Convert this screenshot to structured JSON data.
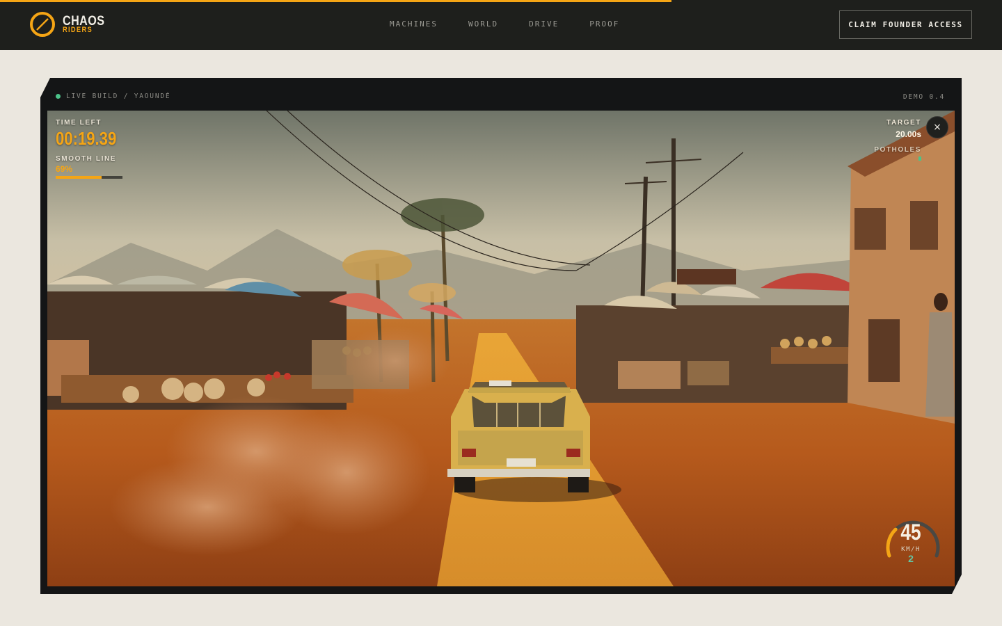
{
  "loading": {
    "progress": 0.67
  },
  "brand": {
    "line1": "CHAOS",
    "line2": "RIDERS",
    "accent": "#f5a515"
  },
  "nav": {
    "items": [
      {
        "label": "MACHINES"
      },
      {
        "label": "WORLD"
      },
      {
        "label": "DRIVE"
      },
      {
        "label": "PROOF"
      }
    ]
  },
  "cta": {
    "label": "CLAIM FOUNDER ACCESS"
  },
  "game": {
    "status_label": "LIVE BUILD / YAOUNDÉ",
    "version": "DEMO 0.4",
    "hud": {
      "time_left_label": "TIME LEFT",
      "time_left": "00:19.39",
      "smooth_line_label": "SMOOTH LINE",
      "smooth_line_value": "69%",
      "smooth_line_fraction": 0.69,
      "target_label": "TARGET",
      "target_value": "20.00s",
      "potholes_label": "POTHOLES"
    },
    "close_icon": "×",
    "speedometer": {
      "speed": "45",
      "unit": "KM/H",
      "gear": "2",
      "fraction": 0.3
    }
  }
}
